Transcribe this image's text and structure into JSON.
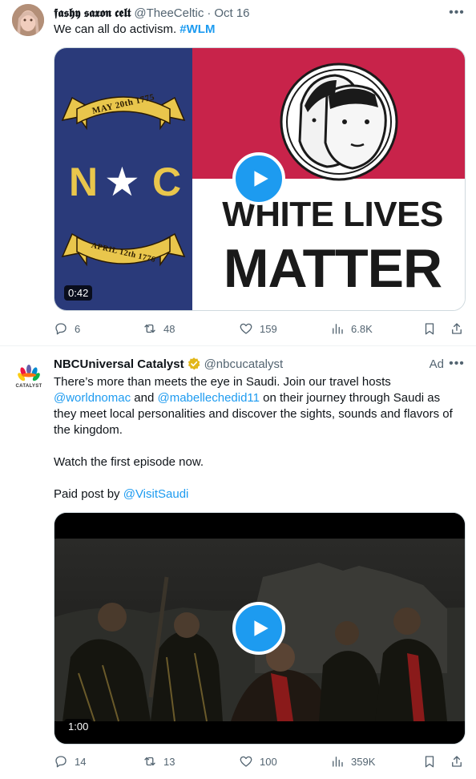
{
  "tweets": [
    {
      "author_name": "𝖋𝖆𝖘𝖍𝖞 𝖘𝖆𝖝𝖔𝖓 𝖈𝖊𝖑𝖙",
      "handle": "@TheeCeltic",
      "separator": "·",
      "time": "Oct 16",
      "text_plain": "We can all do activism. ",
      "hashtag": "#WLM",
      "media": {
        "flag_banner_top": "MAY 20th 1775",
        "flag_banner_bottom": "APRIL 12th 1776",
        "flag_left_letter": "N",
        "flag_star": "★",
        "flag_right_letter": "C",
        "headline_line1": "WHITE LIVES",
        "headline_line2": "MATTER",
        "duration": "0:42"
      },
      "stats": {
        "replies": "6",
        "reposts": "48",
        "likes": "159",
        "views": "6.8K"
      }
    },
    {
      "author_name": "NBCUniversal Catalyst",
      "handle": "@nbcucatalyst",
      "ad_label": "Ad",
      "avatar_text": "CATALYST",
      "text_line1": "There’s more than meets the eye in Saudi. Join our travel hosts",
      "mention1": "@worldnomac",
      "text_and": " and ",
      "mention2": "@mabellechedid11",
      "text_line2_rest": " on their journey through Saudi as they meet local personalities and discover the sights, sounds and flavors of the kingdom.",
      "text_watch": "Watch the first episode now.",
      "text_paid": "Paid post by ",
      "mention3": "@VisitSaudi",
      "media": {
        "duration": "1:00"
      },
      "stats": {
        "replies": "14",
        "reposts": "13",
        "likes": "100",
        "views": "359K"
      }
    }
  ],
  "colors": {
    "accent": "#1d9bf0",
    "secondary_text": "#536471",
    "verified_gold": "#e2b719",
    "flag_blue": "#2a3a7a",
    "flag_red": "#c8234a"
  }
}
